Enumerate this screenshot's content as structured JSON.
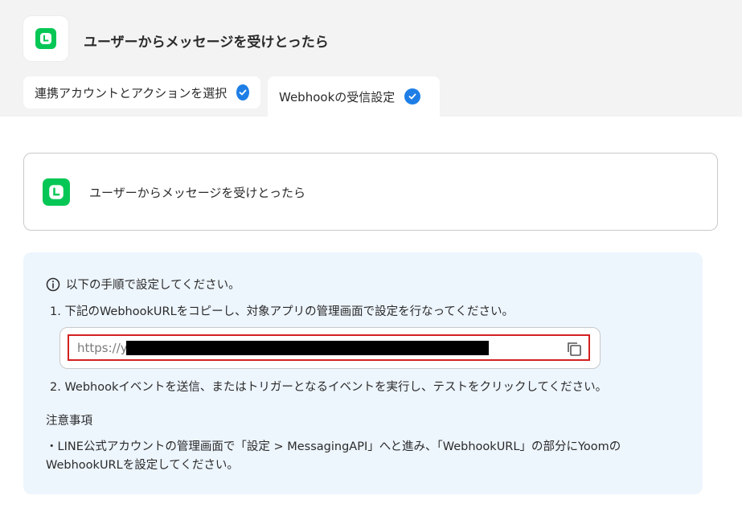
{
  "header": {
    "title": "ユーザーからメッセージを受けとったら"
  },
  "tabs": [
    {
      "label": "連携アカウントとアクションを選択"
    },
    {
      "label": "Webhookの受信設定"
    }
  ],
  "trigger_card": {
    "label": "ユーザーからメッセージを受けとったら"
  },
  "instructions": {
    "intro": "以下の手順で設定してください。",
    "step1": "1. 下記のWebhookURLをコピーし、対象アプリの管理画面で設定を行なってください。",
    "url_visible_prefix": "https://y",
    "step2": "2. Webhookイベントを送信、またはトリガーとなるイベントを実行し、テストをクリックしてください。",
    "note_title": "注意事項",
    "note_line1": "・LINE公式アカウントの管理画面で「設定 > MessagingAPI」へと進み、「WebhookURL」の部分にYoomの",
    "note_line2": "WebhookURLを設定してください。"
  },
  "colors": {
    "line_green": "#06c755",
    "check_blue": "#1e7ee6",
    "url_border_red": "#d32020",
    "panel_bg": "#edf5fd"
  },
  "icons": {
    "app": "line-logo-icon",
    "check": "check-circle-icon",
    "info": "info-circle-icon",
    "copy": "copy-icon"
  }
}
